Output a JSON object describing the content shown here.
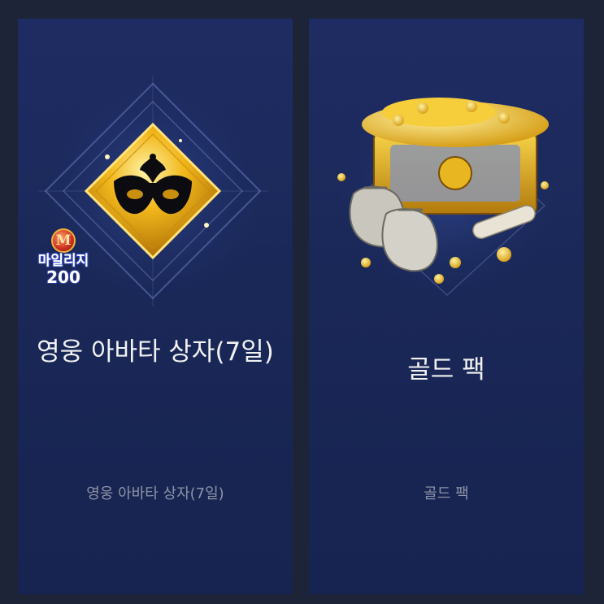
{
  "products": [
    {
      "title": "영웅 아바타 상자(7일)",
      "subtitle": "영웅 아바타 상자(7일)",
      "icon": "mask-icon",
      "badge": {
        "logo_letter": "M",
        "label": "마일리지",
        "value": "200"
      }
    },
    {
      "title": "골드 팩",
      "subtitle": "골드 팩",
      "icon": "gold-chest-icon"
    }
  ],
  "colors": {
    "background": "#1d2438",
    "card": "#1e2c63",
    "title": "#f2f2f2",
    "subtitle": "#8d94a8",
    "gold": "#f2b81c"
  }
}
